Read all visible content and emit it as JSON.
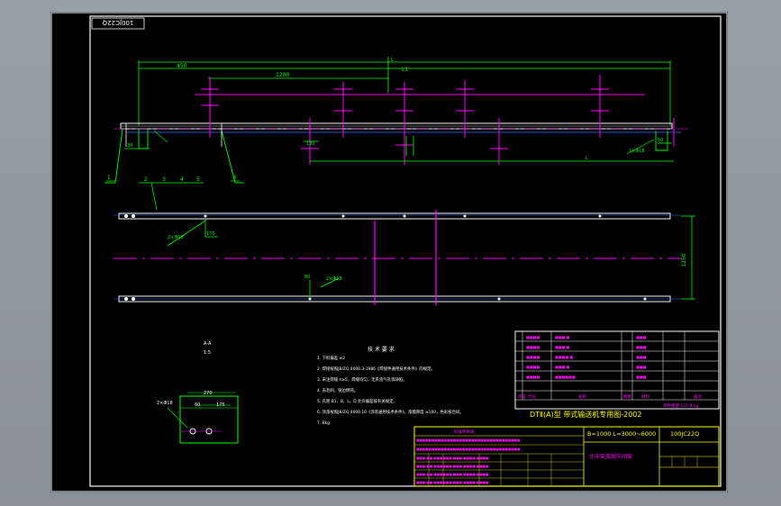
{
  "drawing": {
    "code_stamp": "100JC22Q",
    "title_line": "DTⅡ(A)型 带式输送机专用图-2002",
    "spec_text": "B=1000 L=3000~6000",
    "drawing_no": "100JC22Q",
    "part_name": "头中架支腿中间架",
    "tech_req_heading": "技 术 要 求",
    "tech_reqs": [
      "1. 下料偏差 ±2",
      "2. 焊接按照JB/ZQ 4000.3-1986《焊接件通用技术条件》的规定。",
      "3. 未注焊缝 h≥5，焊缝均匀，无夹渣气孔等缺陷。",
      "4. 去毛刺，锐边倒钝。",
      "5. 孔距 B1、B、L、D 允许偏差按有关规定。",
      "6. 涂漆按照JB/ZQ 4000.10《涂装通用技术条件》，漆膜厚度 ≥100，色彩按合同。",
      "7. Bkg"
    ],
    "section_label": "A-A",
    "scale_label": "1:5",
    "callouts": [
      "1",
      "2",
      "3",
      "4",
      "5",
      "6"
    ],
    "dims": {
      "overall": "L",
      "l1": "L1",
      "d1": "450",
      "d2": "1200",
      "d3": "170",
      "d4": "1250",
      "hole1": "2×Φ18",
      "hole2": "2×Φ18",
      "hole3": "2×Φ18",
      "d_a": "130",
      "d_b": "175",
      "d_c": "30",
      "d_d": "50",
      "d_e": "80",
      "d_f": "270",
      "d_g": "60"
    },
    "bom_header": [
      "序号",
      "代号",
      "名称",
      "数量",
      "材料",
      "备注"
    ],
    "bom_footer": "单件重量 122.8 kg",
    "change_block_heading": "标准件目录"
  },
  "colors": {
    "background": "#000000",
    "frame": "#ffffff",
    "geometry": "#ffffff",
    "dimension": "#00ff00",
    "centerline": "#ff00ff",
    "table_text": "#ff00ff",
    "title_text": "#ffff00",
    "outer": "#8e959c"
  }
}
